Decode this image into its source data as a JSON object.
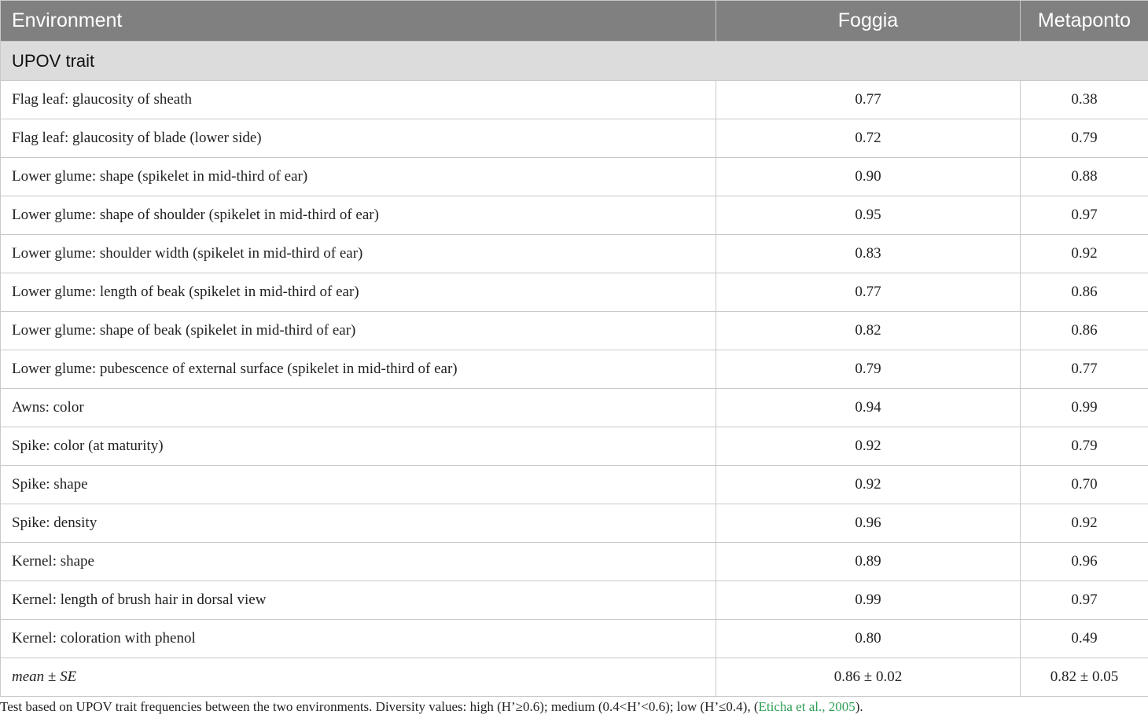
{
  "table": {
    "headers": [
      "Environment",
      "Foggia",
      "Metaponto"
    ],
    "section_label": "UPOV trait",
    "rows": [
      {
        "trait": "Flag leaf: glaucosity of sheath",
        "foggia": "0.77",
        "metaponto": "0.38"
      },
      {
        "trait": "Flag leaf: glaucosity of blade (lower side)",
        "foggia": "0.72",
        "metaponto": "0.79"
      },
      {
        "trait": "Lower glume: shape (spikelet in mid-third of ear)",
        "foggia": "0.90",
        "metaponto": "0.88"
      },
      {
        "trait": "Lower glume: shape of shoulder (spikelet in mid-third of ear)",
        "foggia": "0.95",
        "metaponto": "0.97"
      },
      {
        "trait": "Lower glume: shoulder width (spikelet in mid-third of ear)",
        "foggia": "0.83",
        "metaponto": "0.92"
      },
      {
        "trait": "Lower glume: length of beak (spikelet in mid-third of ear)",
        "foggia": "0.77",
        "metaponto": "0.86"
      },
      {
        "trait": "Lower glume: shape of beak (spikelet in mid-third of ear)",
        "foggia": "0.82",
        "metaponto": "0.86"
      },
      {
        "trait": "Lower glume: pubescence of external surface (spikelet in mid-third of ear)",
        "foggia": "0.79",
        "metaponto": "0.77"
      },
      {
        "trait": "Awns: color",
        "foggia": "0.94",
        "metaponto": "0.99"
      },
      {
        "trait": "Spike: color (at maturity)",
        "foggia": "0.92",
        "metaponto": "0.79"
      },
      {
        "trait": "Spike: shape",
        "foggia": "0.92",
        "metaponto": "0.70"
      },
      {
        "trait": "Spike: density",
        "foggia": "0.96",
        "metaponto": "0.92"
      },
      {
        "trait": "Kernel: shape",
        "foggia": "0.89",
        "metaponto": "0.96"
      },
      {
        "trait": "Kernel: length of brush hair in dorsal view",
        "foggia": "0.99",
        "metaponto": "0.97"
      },
      {
        "trait": "Kernel: coloration with phenol",
        "foggia": "0.80",
        "metaponto": "0.49"
      }
    ],
    "mean_row": {
      "label": "mean ± SE",
      "foggia": "0.86 ± 0.02",
      "metaponto": "0.82 ± 0.05"
    }
  },
  "footnote": {
    "text": "Test based on UPOV trait frequencies between the two environments. Diversity values: high (H’≥0.6); medium (0.4<H’<0.6); low (H’≤0.4), (",
    "reference": "Eticha et al., 2005",
    "suffix": ")."
  },
  "colors": {
    "header_bg": "#808080",
    "section_bg": "#dcdcdc",
    "reference_link": "#2e9e56"
  }
}
